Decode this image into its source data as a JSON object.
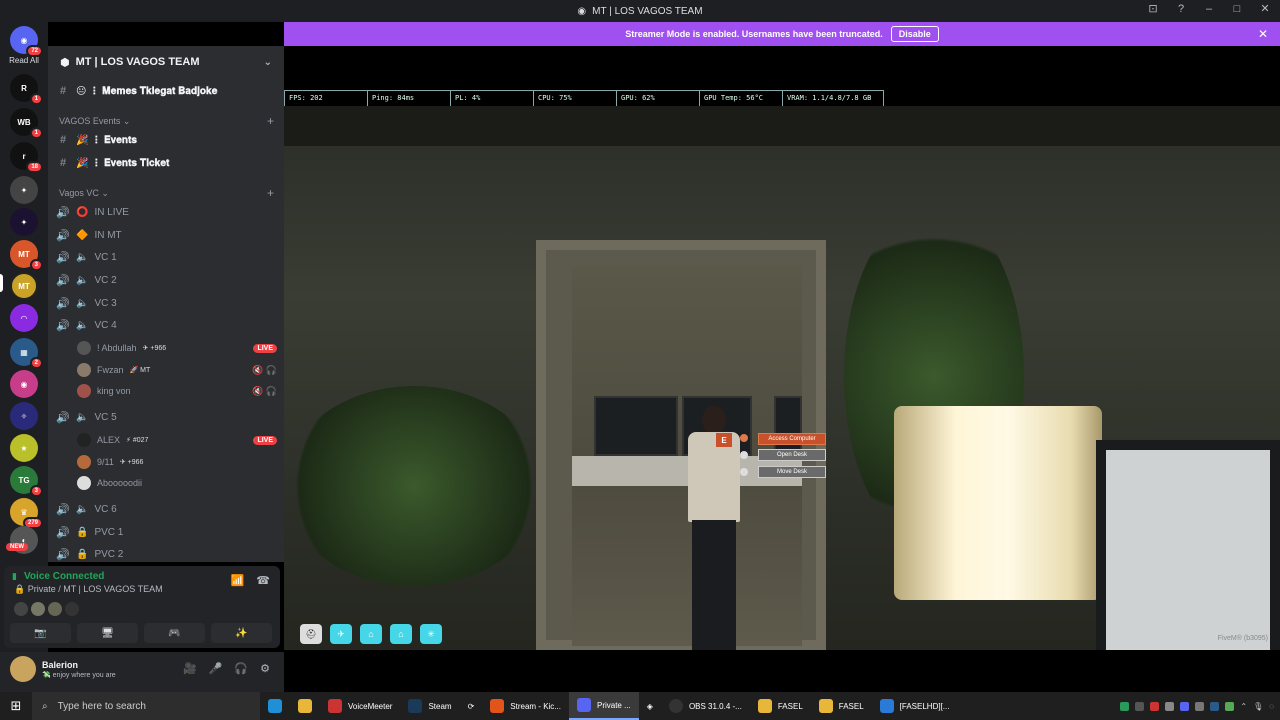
{
  "window": {
    "title": "MT | LOS VAGOS TEAM",
    "controls": [
      "⊡",
      "?",
      "–",
      "□",
      "✕"
    ]
  },
  "banner": {
    "text": "Streamer Mode is enabled. Usernames have been truncated.",
    "button": "Disable"
  },
  "guilds": {
    "read_all": "Read All",
    "home_badge": "72",
    "badges": [
      "1",
      "1",
      "18",
      "3",
      "2",
      "3",
      "279"
    ],
    "new_label": "NEW"
  },
  "server": {
    "name": "MT | LOS VAGOS TEAM",
    "top_channel": "😐 ⋮ 𝐌𝐞𝐦𝐞𝐬 𝐓𝐤𝐥𝐞𝐠𝐚𝐭 𝐁𝐚𝐝𝐣𝐨𝐤𝐞",
    "categories": [
      {
        "name": "VAGOS Events ⌄",
        "channels": [
          "🎉 ⋮ 𝐄𝐯𝐞𝐧𝐭𝐬",
          "🎉 ⋮ 𝐄𝐯𝐞𝐧𝐭𝐬 𝐓𝐢𝐜𝐤𝐞𝐭"
        ]
      },
      {
        "name": "Vagos VC ⌄"
      }
    ],
    "voice": [
      {
        "name": "IN LIVE",
        "glyph": "⭕"
      },
      {
        "name": "IN MT",
        "glyph": "🔶"
      },
      {
        "name": "VC 1",
        "glyph": "🔈"
      },
      {
        "name": "VC 2",
        "glyph": "🔈"
      },
      {
        "name": "VC 3",
        "glyph": "🔈"
      },
      {
        "name": "VC 4",
        "glyph": "🔈"
      },
      {
        "name": "VC 5",
        "glyph": "🔈"
      },
      {
        "name": "VC 6",
        "glyph": "🔈"
      },
      {
        "name": "PVC 1",
        "glyph": "🔒"
      },
      {
        "name": "PVC 2",
        "glyph": "🔒"
      }
    ],
    "vc4_users": [
      {
        "name": "! Abdullah",
        "tag": "✈ +966",
        "live": "LIVE"
      },
      {
        "name": "Fwzan",
        "tag": "🚀 MT",
        "icons": "🔇 🎧"
      },
      {
        "name": "king von",
        "tag": "",
        "icons": "🔇 🎧"
      }
    ],
    "vc5_users": [
      {
        "name": "ALEX",
        "tag": "⚡ #027",
        "live": "LIVE"
      },
      {
        "name": "9/11",
        "tag": "✈ +966"
      },
      {
        "name": "Abooooodii",
        "tag": ""
      }
    ]
  },
  "voice_panel": {
    "status": "Voice Connected",
    "channel": "🔒 Private / MT | LOS VAGOS TEAM",
    "icons": [
      "📶",
      "☎"
    ],
    "buttons": [
      "📷",
      "🖥",
      "🎮",
      "✨"
    ]
  },
  "user": {
    "name": "Balerion",
    "status": "💸 enjoy where you are",
    "controls": [
      "🎥",
      "🎤",
      "🎧",
      "⚙"
    ]
  },
  "game": {
    "overlay": [
      "FPS: 202",
      "Ping: 84ms",
      "PL: 4%",
      "CPU: 75%",
      "GPU: 62%",
      "GPU Temp: 56°C",
      "VRAM: 1.1/4.8/7.8 GB"
    ],
    "interact_key": "E",
    "interact_options": [
      "Access Computer",
      "Open Desk",
      "Move Desk"
    ],
    "fivem_label": "FiveM® (b3095)",
    "hud_icons": [
      "⛑",
      "✈",
      "⌂",
      "⌂",
      "✳"
    ]
  },
  "taskbar": {
    "search_placeholder": "Type here to search",
    "items": [
      "VoiceMeeter",
      "Steam",
      "Stream - Kic...",
      "Private ...",
      "OBS 31.0.4 -...",
      "FASEL",
      "FASEL",
      "[FASELHD][..."
    ],
    "active_index": 3,
    "tray_time": ""
  }
}
